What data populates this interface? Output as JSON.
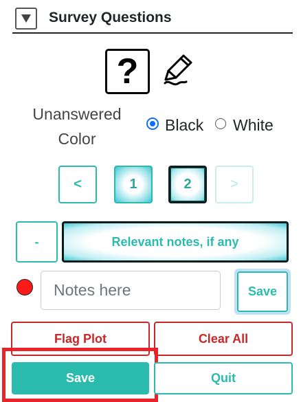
{
  "header": {
    "title": "Survey Questions",
    "collapse_icon": "triangle-down-icon"
  },
  "icons": {
    "help": "question-mark-icon",
    "help_glyph": "?",
    "pen": "pen-icon"
  },
  "unanswered_color": {
    "label_line1": "Unanswered",
    "label_line2": "Color",
    "options": [
      {
        "label": "Black",
        "selected": true
      },
      {
        "label": "White",
        "selected": false
      }
    ]
  },
  "pagination": {
    "prev_label": "<",
    "pages": [
      "1",
      "2"
    ],
    "current_page": "2",
    "next_label": ">"
  },
  "notes": {
    "collapse_label": "-",
    "toggle_label": "Relevant notes, if any",
    "input_placeholder": "Notes here",
    "input_value": "",
    "save_label": "Save",
    "status_color": "#ff1a1a"
  },
  "actions": {
    "flag_label": "Flag Plot",
    "clear_label": "Clear All",
    "save_label": "Save",
    "quit_label": "Quit"
  },
  "colors": {
    "accent": "#2bbbad",
    "danger": "#c62828",
    "highlight": "#e8232a",
    "radio": "#0d6efd"
  }
}
